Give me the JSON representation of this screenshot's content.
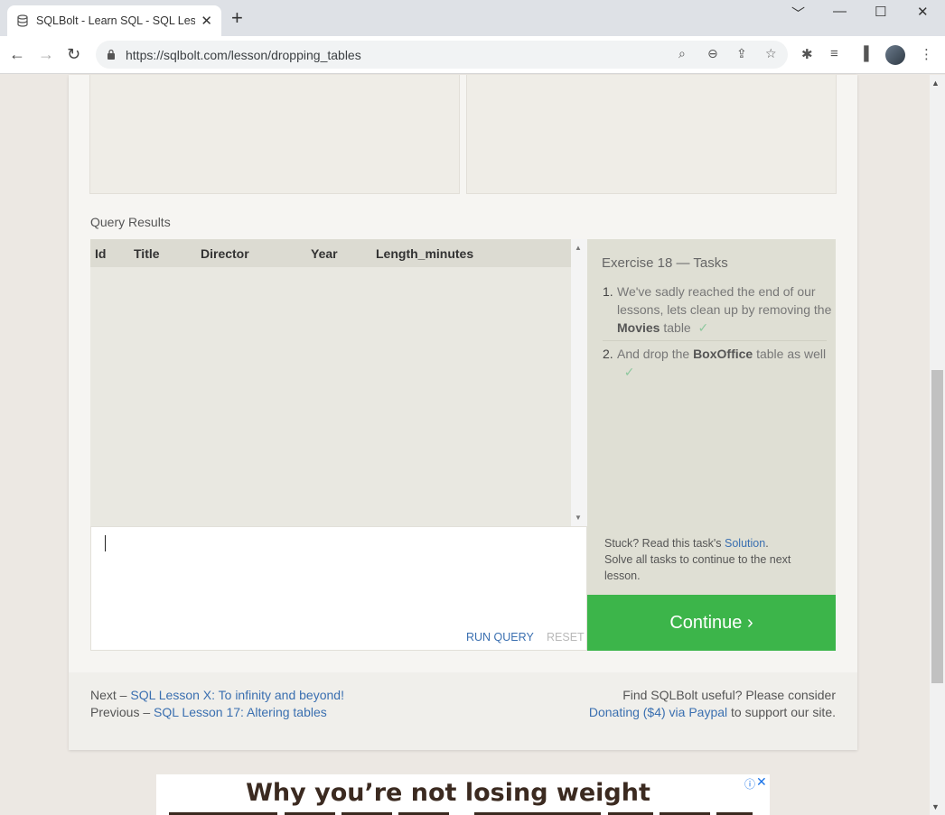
{
  "browser": {
    "tab_title": "SQLBolt - Learn SQL - SQL Lesson",
    "tab_close": "✕",
    "new_tab": "+",
    "url": "https://sqlbolt.com/lesson/dropping_tables",
    "window_controls": [
      "﹀",
      "—",
      "☐",
      "✕"
    ]
  },
  "page": {
    "query_results_label": "Query Results",
    "columns": [
      "Id",
      "Title",
      "Director",
      "Year",
      "Length_minutes"
    ],
    "rows": [],
    "run_query": "RUN QUERY",
    "reset": "RESET",
    "tasks_title": "Exercise 18 — Tasks",
    "tasks": [
      {
        "number": "1.",
        "before": "We've sadly reached the end of our lessons, lets clean up by removing the ",
        "bold": "Movies",
        "after": " table",
        "done": true
      },
      {
        "number": "2.",
        "before": "And drop the ",
        "bold": "BoxOffice",
        "after": " table as well",
        "done": true
      }
    ],
    "check_mark": "✓",
    "stuck_prefix": "Stuck? Read this task's ",
    "solution_link": "Solution",
    "stuck_suffix": ".",
    "solve_all": "Solve all tasks to continue to the next lesson.",
    "continue_label": "Continue ›"
  },
  "footer": {
    "next_prefix": "Next – ",
    "next_link": "SQL Lesson X: To infinity and beyond!",
    "previous_prefix": "Previous – ",
    "previous_link": "SQL Lesson 17: Altering tables",
    "useful_text": "Find SQLBolt useful? Please consider",
    "donate_link": "Donating ($4) via Paypal",
    "donate_suffix": " to support our site."
  },
  "ad": {
    "headline": "Why you’re not losing weight",
    "info": "ⓘ",
    "close": "✕"
  },
  "colors": {
    "continue_green": "#3cb54a",
    "link_blue": "#3a6fb0",
    "tasks_bg": "#dfdfd4"
  }
}
